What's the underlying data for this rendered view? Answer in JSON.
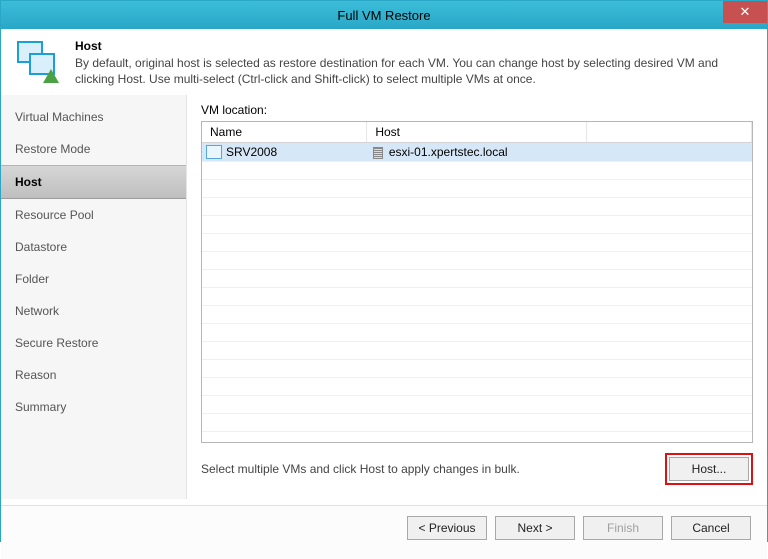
{
  "window": {
    "title": "Full VM Restore",
    "close": "✕"
  },
  "header": {
    "title": "Host",
    "description": "By default, original host is selected as restore destination for each VM. You can change host by selecting desired VM and clicking Host. Use multi-select (Ctrl-click and Shift-click) to select multiple VMs at once."
  },
  "sidebar": {
    "items": [
      {
        "label": "Virtual Machines"
      },
      {
        "label": "Restore Mode"
      },
      {
        "label": "Host"
      },
      {
        "label": "Resource Pool"
      },
      {
        "label": "Datastore"
      },
      {
        "label": "Folder"
      },
      {
        "label": "Network"
      },
      {
        "label": "Secure Restore"
      },
      {
        "label": "Reason"
      },
      {
        "label": "Summary"
      }
    ],
    "active_index": 2
  },
  "main": {
    "label": "VM location:",
    "columns": {
      "name": "Name",
      "host": "Host"
    },
    "rows": [
      {
        "name": "SRV2008",
        "host": "esxi-01.xpertstec.local",
        "selected": true
      }
    ],
    "hint": "Select multiple VMs and click Host to apply changes in bulk.",
    "host_button": "Host..."
  },
  "footer": {
    "previous": "< Previous",
    "next": "Next >",
    "finish": "Finish",
    "cancel": "Cancel"
  }
}
